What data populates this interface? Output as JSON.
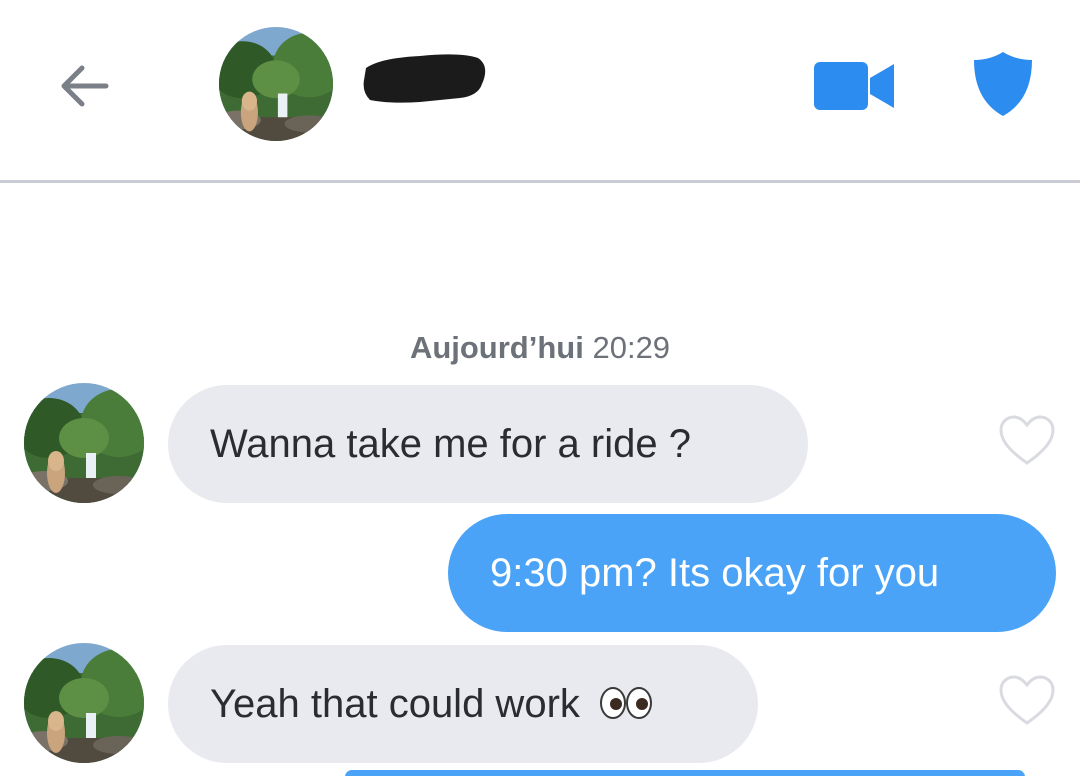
{
  "header": {
    "contact_name_redacted": true,
    "icons": [
      "back-arrow-icon",
      "video-camera-icon",
      "shield-icon"
    ],
    "accent_color": "#2d8cf0"
  },
  "conversation": {
    "day_label": "Aujourd’hui",
    "time_label": "20:29",
    "messages": [
      {
        "direction": "received",
        "text": "Wanna take me for a ride ?",
        "liked": false
      },
      {
        "direction": "sent",
        "text": "9:30 pm? Its okay for you"
      },
      {
        "direction": "received",
        "text": "Yeah that could work",
        "emoji": "eyes-emoji",
        "liked": false
      }
    ]
  },
  "colors": {
    "sent_bubble": "#4aa3f7",
    "received_bubble": "#e9eaef",
    "divider": "#c9ccd3",
    "timestamp_text": "#6d7179"
  }
}
